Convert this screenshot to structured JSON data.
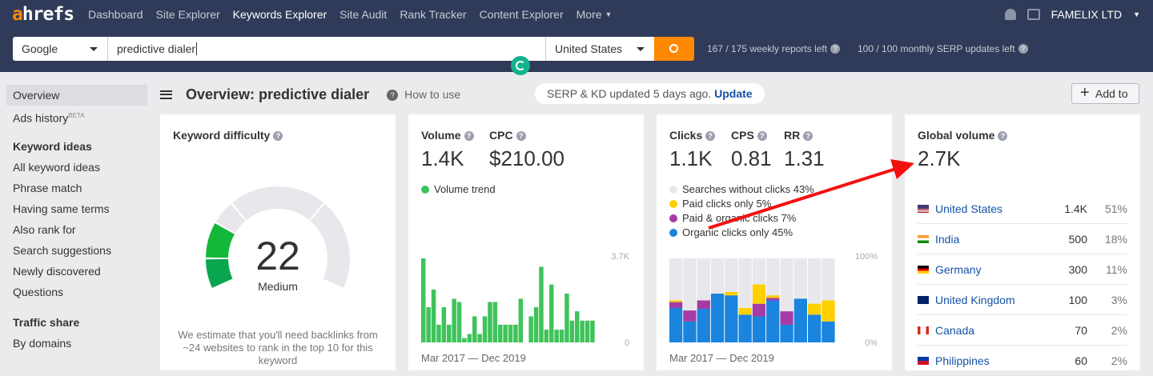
{
  "brand": {
    "logo": "ahrefs"
  },
  "nav": {
    "items": [
      "Dashboard",
      "Site Explorer",
      "Keywords Explorer",
      "Site Audit",
      "Rank Tracker",
      "Content Explorer",
      "More"
    ],
    "active": "Keywords Explorer",
    "account": "FAMELIX LTD"
  },
  "search": {
    "engine": "Google",
    "keyword": "predictive dialer",
    "country": "United States",
    "weekly": "167 / 175 weekly reports left",
    "monthly": "100 / 100 monthly SERP updates left"
  },
  "sidebar": {
    "items": [
      {
        "label": "Overview",
        "selected": true
      },
      {
        "label": "Ads history",
        "badge": "BETA"
      }
    ],
    "keyword_ideas_heading": "Keyword ideas",
    "keyword_ideas": [
      "All keyword ideas",
      "Phrase match",
      "Having same terms",
      "Also rank for",
      "Search suggestions",
      "Newly discovered",
      "Questions"
    ],
    "traffic_heading": "Traffic share",
    "traffic": [
      "By domains"
    ]
  },
  "header": {
    "title": "Overview: predictive dialer",
    "how_to": "How to use",
    "serp_status": "SERP & KD updated 5 days ago.",
    "update": "Update",
    "add_to": "Add to"
  },
  "kd": {
    "title": "Keyword difficulty",
    "value": "22",
    "label": "Medium",
    "score": 22,
    "estimate": "We estimate that you'll need backlinks from ~24 websites to rank in the top 10 for this keyword",
    "color": "#0db14b"
  },
  "volume": {
    "volume_label": "Volume",
    "volume": "1.4K",
    "cpc_label": "CPC",
    "cpc": "$210.00",
    "trend_label": "Volume trend",
    "date_range": "Mar 2017 — Dec 2019"
  },
  "clicks": {
    "clicks_label": "Clicks",
    "clicks": "1.1K",
    "cps_label": "CPS",
    "cps": "0.81",
    "rr_label": "RR",
    "rr": "1.31",
    "legend": [
      "Searches without clicks 43%",
      "Paid clicks only 5%",
      "Paid & organic clicks 7%",
      "Organic clicks only 45%"
    ],
    "colors": [
      "#e8e8ec",
      "#ffd000",
      "#a53ba5",
      "#1a84de"
    ],
    "date_range": "Mar 2017 — Dec 2019"
  },
  "global": {
    "title": "Global volume",
    "value": "2.7K",
    "countries": [
      {
        "name": "United States",
        "volume": "1.4K",
        "pct": "51%",
        "flag": "us"
      },
      {
        "name": "India",
        "volume": "500",
        "pct": "18%",
        "flag": "in"
      },
      {
        "name": "Germany",
        "volume": "300",
        "pct": "11%",
        "flag": "de"
      },
      {
        "name": "United Kingdom",
        "volume": "100",
        "pct": "3%",
        "flag": "gb"
      },
      {
        "name": "Canada",
        "volume": "70",
        "pct": "2%",
        "flag": "ca"
      },
      {
        "name": "Philippines",
        "volume": "60",
        "pct": "2%",
        "flag": "ph"
      }
    ]
  },
  "chart_data": [
    {
      "type": "bar",
      "title": "Volume trend",
      "ylim": [
        0,
        3700
      ],
      "ytick_labels": [
        "3.7K",
        "0"
      ],
      "xlabel": "Mar 2017 — Dec 2019",
      "color": "#3fc35b",
      "values": [
        3700,
        1550,
        2330,
        780,
        1550,
        780,
        1920,
        1780,
        190,
        370,
        1150,
        370,
        1150,
        1780,
        1780,
        780,
        780,
        780,
        780,
        1920,
        0,
        1150,
        1550,
        3330,
        560,
        2550,
        560,
        560,
        2150,
        960,
        1370,
        960,
        960,
        960
      ]
    },
    {
      "type": "bar",
      "stacked": true,
      "ylim": [
        0,
        100
      ],
      "ytick_labels": [
        "100%",
        "0%"
      ],
      "xlabel": "Mar 2017 — Dec 2019",
      "series": [
        {
          "name": "Organic clicks only",
          "values": [
            41,
            25,
            40,
            58,
            56,
            33,
            31,
            50,
            21,
            52,
            33,
            25
          ]
        },
        {
          "name": "Paid & organic clicks",
          "values": [
            7,
            13,
            10,
            0,
            0,
            0,
            15,
            3,
            16,
            0,
            0,
            0
          ]
        },
        {
          "name": "Paid clicks only",
          "values": [
            2,
            0,
            0,
            0,
            4,
            8,
            23,
            3,
            0,
            0,
            13,
            25
          ]
        }
      ]
    }
  ]
}
